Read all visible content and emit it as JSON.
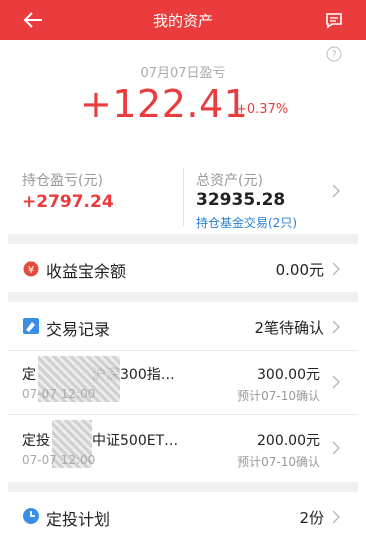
{
  "header": {
    "title": "我的资产"
  },
  "summary": {
    "date": "07月07日盈亏",
    "profit": "+122.41",
    "percent": "+0.37%"
  },
  "holdings": {
    "label": "持仓盈亏(元)",
    "value": "+2797.24"
  },
  "assets": {
    "label": "总资产(元)",
    "value": "32935.28",
    "link": "持仓基金交易(2只)"
  },
  "balance": {
    "label": "收益宝余额",
    "value": "0.00元"
  },
  "transactions": {
    "label": "交易记录",
    "status": "2笔待确认",
    "items": [
      {
        "name": "定　　　　沪深300指…",
        "time": "07-07 12:00",
        "amount": "300.00元",
        "note": "预计07-10确认"
      },
      {
        "name": "定投　　　中证500ET…",
        "time": "07-07 12:00",
        "amount": "200.00元",
        "note": "预计07-10确认"
      }
    ]
  },
  "plan": {
    "label": "定投计划",
    "value": "2份"
  },
  "colors": {
    "accent": "#ea3c3c",
    "link": "#2a7fd4"
  }
}
